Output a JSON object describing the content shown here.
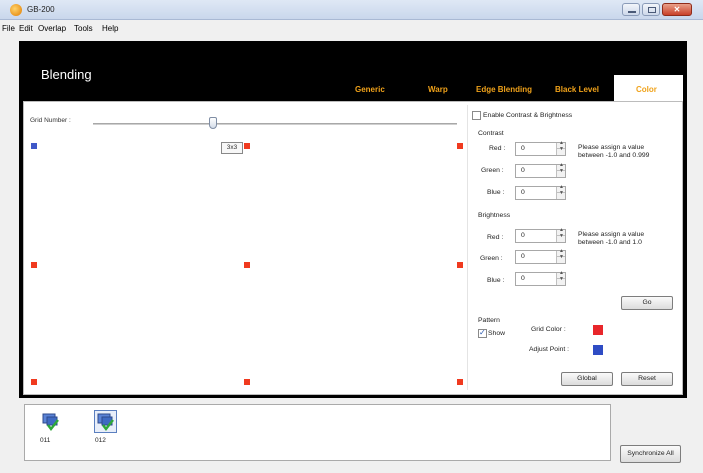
{
  "window": {
    "title": "GB-200",
    "controls": {
      "minimize": "",
      "maximize": "",
      "close": "✕"
    }
  },
  "menu": [
    "File",
    "Edit",
    "Overlap",
    "Tools",
    "Help"
  ],
  "header": {
    "heading": "Blending",
    "tabs": [
      "Generic",
      "Warp",
      "Edge Blending",
      "Black Level",
      "Color"
    ],
    "active_tab": "Color"
  },
  "grid": {
    "label": "Grid Number :",
    "value_tooltip": "3x3",
    "slider_fraction": 0.33
  },
  "color_panel": {
    "enable_label": "Enable Contrast & Brightness",
    "enable_checked": false,
    "contrast": {
      "title": "Contrast",
      "rows": [
        {
          "label": "Red :",
          "value": "0"
        },
        {
          "label": "Green :",
          "value": "0"
        },
        {
          "label": "Blue :",
          "value": "0"
        }
      ],
      "hint_line1": "Please assign a value",
      "hint_line2": "between -1.0 and 0.999"
    },
    "brightness": {
      "title": "Brightness",
      "rows": [
        {
          "label": "Red :",
          "value": "0"
        },
        {
          "label": "Green :",
          "value": "0"
        },
        {
          "label": "Blue :",
          "value": "0"
        }
      ],
      "hint_line1": "Please assign a value",
      "hint_line2": "between -1.0 and 1.0"
    },
    "go_label": "Go",
    "pattern": {
      "title": "Pattern",
      "show_label": "Show",
      "show_checked": true,
      "grid_color_label": "Grid Color :",
      "grid_color": "#e8262b",
      "adjust_point_label": "Adjust Point :",
      "adjust_point_color": "#2f4cc4"
    },
    "global_label": "Global",
    "reset_label": "Reset"
  },
  "devices": [
    {
      "label": "011",
      "selected": false
    },
    {
      "label": "012",
      "selected": true
    }
  ],
  "synchronize_label": "Synchronize All",
  "colors": {
    "tab_accent": "#f0a21a",
    "grid_point": "#f03a1f",
    "selected_point": "#3f58c8",
    "header_bg": "#000000"
  }
}
